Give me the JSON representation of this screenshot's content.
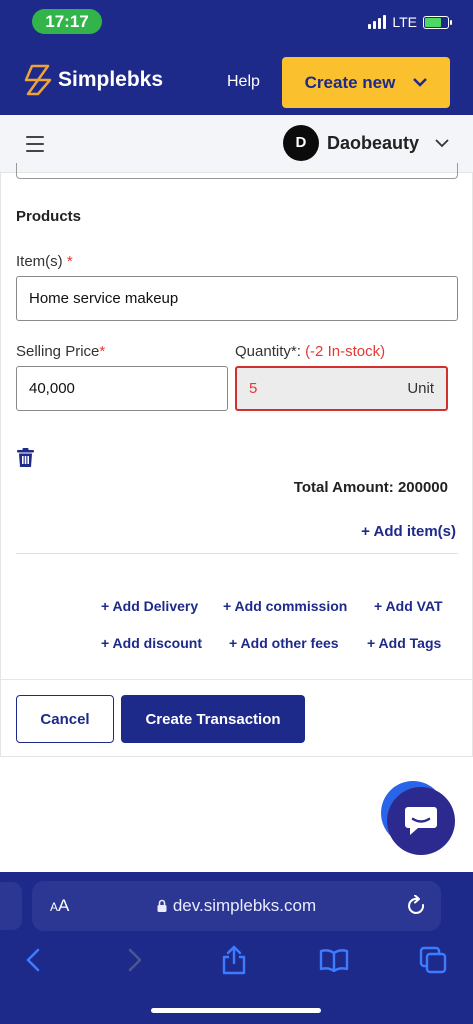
{
  "status_bar": {
    "time": "17:17",
    "network": "LTE"
  },
  "header": {
    "brand": "Simplebks",
    "help": "Help",
    "create_new": "Create new"
  },
  "subbar": {
    "avatar_letter": "D",
    "business_name": "Daobeauty"
  },
  "form": {
    "section_title": "Products",
    "items_label": "Item(s)",
    "required_mark": "*",
    "item_value": "Home service makeup",
    "price_label": "Selling Price",
    "price_value": "40,000",
    "quantity_label": "Quantity",
    "stock_note": "(-2 In-stock)",
    "quantity_value": "5",
    "quantity_unit": "Unit",
    "total_label": "Total Amount: 200000",
    "add_items": "+ Add item(s)",
    "links": {
      "add_delivery": "+ Add Delivery",
      "add_commission": "+ Add commission",
      "add_vat": "+ Add VAT",
      "add_discount": "+ Add discount",
      "add_other_fees": "+ Add other fees",
      "add_tags": "+ Add Tags"
    },
    "cancel": "Cancel",
    "create_transaction": "Create Transaction"
  },
  "browser": {
    "text_size": "AA",
    "url": "dev.simplebks.com"
  },
  "colors": {
    "primary": "#1e2a8a",
    "accent": "#fbc02d",
    "error": "#e53935"
  }
}
